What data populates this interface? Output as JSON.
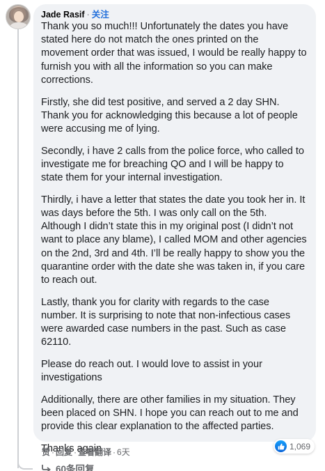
{
  "comment": {
    "author": "Jade Rasif",
    "separator": "·",
    "follow_label": "关注",
    "paragraphs": [
      "Thank you so much!!! Unfortunately the dates you have stated here do not match the ones printed on the movement order that was issued, I would be really happy to furnish you with all the information so you can make corrections.",
      "Firstly, she did test positive, and served a 2 day SHN. Thank you for acknowledging this because a lot of people were accusing me of lying.",
      "Secondly, i have 2 calls from the police force, who called to investigate me for breaching QO and I will be happy to state them for your internal investigation.",
      "Thirdly, i have a letter that states the date you took her in. It was days before the 5th. I was only call on the 5th. Although I didn’t state this in my original post (I didn’t not want to place any blame), I called MOM and other agencies on the 2nd, 3rd and 4th. I’ll be really happy to show you the quarantine order with the date she was taken in, if you care to reach out.",
      "Lastly, thank you for clarity with regards to the case number. It is surprising to note that non-infectious cases were awarded case numbers in the past. Such as case 62110.",
      "Please do reach out. I would love to assist in your investigations",
      "Additionally, there are other families in my situation. They been placed on SHN. I hope you can reach out to me and provide this clear explanation to the affected parties.",
      "Thanks again"
    ]
  },
  "reactions": {
    "icon": "like-icon",
    "count": "1,069",
    "accent": "#1877f2"
  },
  "actions": {
    "like": "赞",
    "reply": "回复",
    "translate": "查看翻译",
    "dot": "·",
    "time": "6天"
  },
  "replies": {
    "icon": "reply-arrow-icon",
    "label": "60条回复"
  }
}
